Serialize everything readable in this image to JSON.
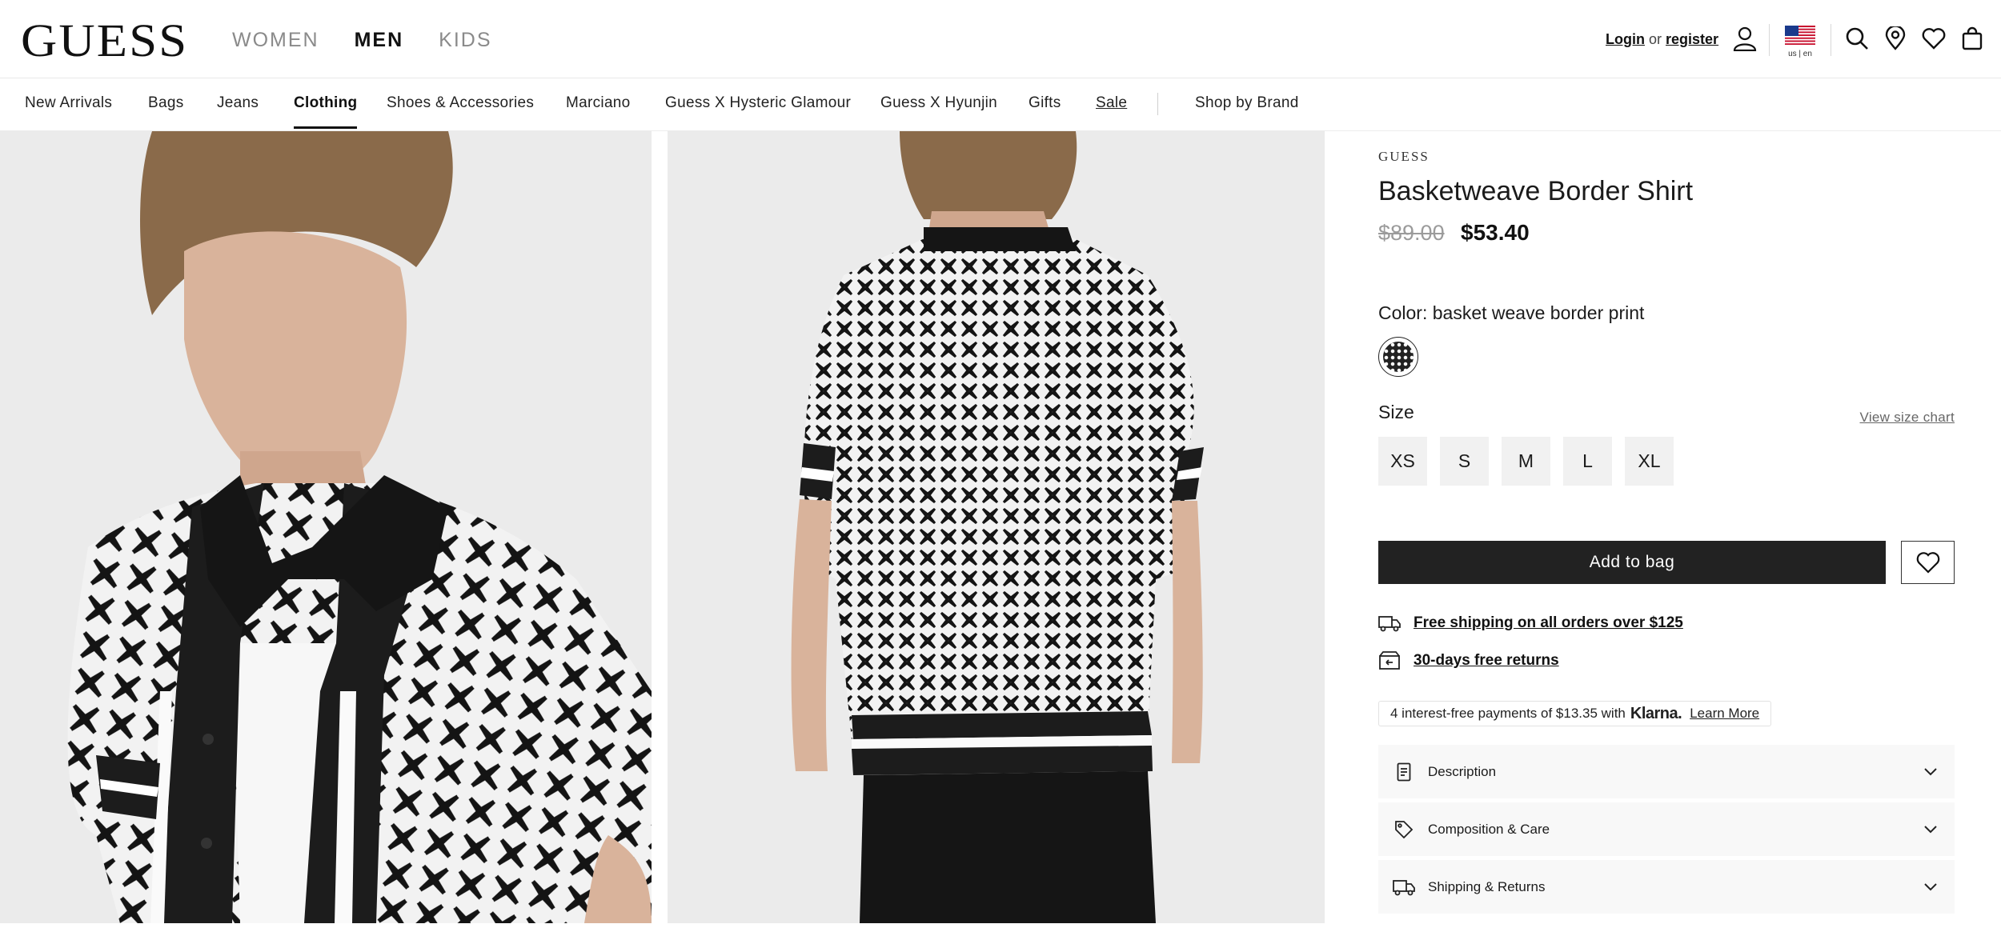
{
  "header": {
    "logo": "GUESS",
    "gender_tabs": [
      {
        "label": "WOMEN",
        "active": false
      },
      {
        "label": "MEN",
        "active": true
      },
      {
        "label": "KIDS",
        "active": false
      }
    ],
    "login_label": "Login",
    "or_label": "or",
    "register_label": "register",
    "locale_label": "us | en",
    "icons": [
      "account-icon",
      "us-flag-icon",
      "search-icon",
      "store-locator-icon",
      "wishlist-icon",
      "bag-icon"
    ]
  },
  "category_nav": [
    {
      "label": "New Arrivals"
    },
    {
      "label": "Bags"
    },
    {
      "label": "Jeans"
    },
    {
      "label": "Clothing",
      "active": true
    },
    {
      "label": "Shoes & Accessories"
    },
    {
      "label": "Marciano"
    },
    {
      "label": "Guess X Hysteric Glamour"
    },
    {
      "label": "Guess X Hyunjin"
    },
    {
      "label": "Gifts"
    },
    {
      "label": "Sale"
    },
    {
      "label": "Shop by Brand"
    }
  ],
  "product": {
    "brand": "GUESS",
    "title": "Basketweave Border Shirt",
    "price_original": "$89.00",
    "price_sale": "$53.40",
    "color_label": "Color: basket weave border print",
    "size_label": "Size",
    "size_chart_label": "View size chart",
    "sizes": [
      "XS",
      "S",
      "M",
      "L",
      "XL"
    ],
    "add_to_bag_label": "Add to bag",
    "shipping_perk": "Free shipping on all orders over $125",
    "returns_perk": "30-days free returns",
    "klarna": {
      "prefix": "4 interest-free payments of $13.35 with",
      "brand": "Klarna.",
      "link": "Learn More"
    },
    "accordions": [
      {
        "label": "Description",
        "icon": "document-icon"
      },
      {
        "label": "Composition & Care",
        "icon": "tag-icon"
      },
      {
        "label": "Shipping & Returns",
        "icon": "truck-icon"
      }
    ]
  },
  "colors": {
    "primary_button": "#222222",
    "text": "#1b1b1b",
    "muted": "#9b9b9b",
    "accordion_bg": "#f8f8f8"
  }
}
